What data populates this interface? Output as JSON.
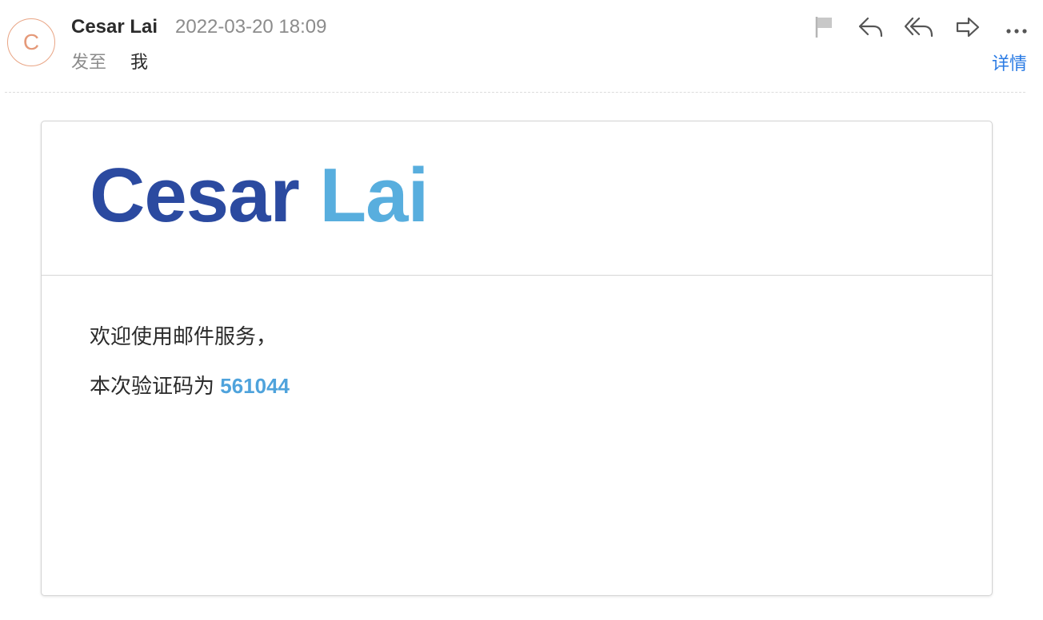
{
  "sender": {
    "avatar_letter": "C",
    "name": "Cesar Lai",
    "time": "2022-03-20 18:09",
    "to_label": "发至",
    "to_value": "我"
  },
  "toolbar": {
    "flag_icon": "flag-icon",
    "reply_icon": "reply-icon",
    "reply_all_icon": "reply-all-icon",
    "forward_icon": "forward-icon",
    "more_icon": "more-icon",
    "details_label": "详情"
  },
  "email": {
    "brand_first": "Cesar",
    "brand_last": "Lai",
    "greeting": "欢迎使用邮件服务，",
    "code_prefix": "本次验证码为",
    "code": "561044"
  },
  "colors": {
    "brand_dark_blue": "#2b4aa0",
    "brand_light_blue": "#58aede",
    "link_blue": "#2a7be4",
    "avatar_orange": "#e59a7a"
  }
}
